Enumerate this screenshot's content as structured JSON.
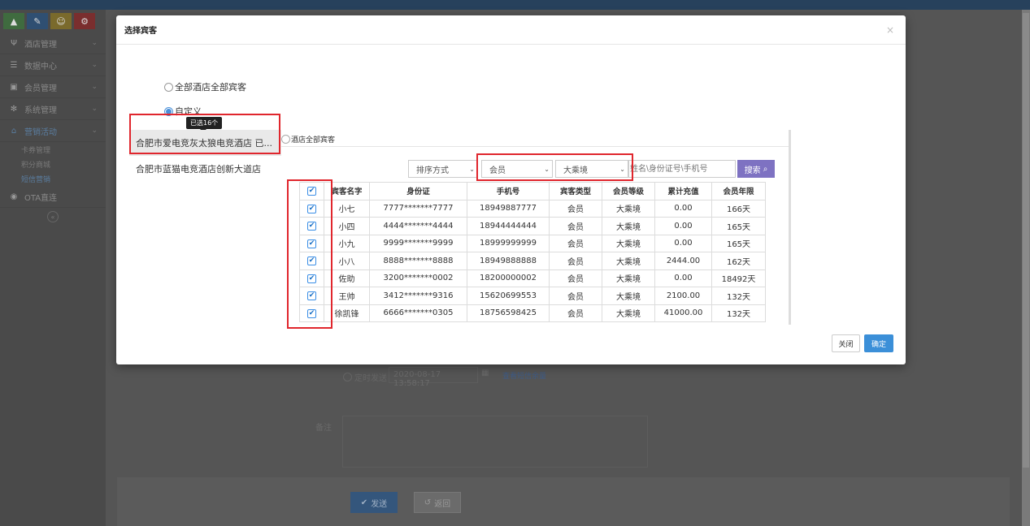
{
  "background": {
    "sidebar": {
      "top_icons": [
        "chart-icon",
        "pencil-icon",
        "users-icon",
        "cogs-icon"
      ],
      "items": [
        {
          "icon": "fork-icon",
          "label": "酒店管理"
        },
        {
          "icon": "database-icon",
          "label": "数据中心"
        },
        {
          "icon": "id-card-icon",
          "label": "会员管理"
        },
        {
          "icon": "gear-icon",
          "label": "系统管理"
        },
        {
          "icon": "gift-icon",
          "label": "营销活动"
        }
      ],
      "sub_items": [
        "卡券管理",
        "积分商城",
        "短信营销"
      ],
      "ota": {
        "icon": "eye-icon",
        "label": "OTA直连"
      }
    },
    "form": {
      "timed_send_label": "定时发送",
      "datetime_value": "2020-08-17 13:58:17",
      "check_sms_link": "查看短信余量",
      "note_label": "备注",
      "send_button": "发送",
      "back_button": "返回"
    }
  },
  "modal": {
    "title": "选择宾客",
    "close_symbol": "×",
    "option_all": "全部酒店全部宾客",
    "option_custom": "自定义",
    "tooltip": "已选16个",
    "hotels": [
      "合肥市爱电竞灰太狼电竞酒店  已...",
      "合肥市蓝猫电竞酒店创新大道店"
    ],
    "all_guests_label": "酒店全部宾客",
    "filters": {
      "sort": "排序方式",
      "type": "会员",
      "level": "大乘境",
      "search_placeholder": "姓名\\身份证号\\手机号",
      "search_button": "搜索"
    },
    "table": {
      "headers": [
        "宾客名字",
        "身份证",
        "手机号",
        "宾客类型",
        "会员等级",
        "累计充值",
        "会员年限"
      ],
      "rows": [
        [
          "小七",
          "7777*******7777",
          "18949887777",
          "会员",
          "大乘境",
          "0.00",
          "166天"
        ],
        [
          "小四",
          "4444*******4444",
          "18944444444",
          "会员",
          "大乘境",
          "0.00",
          "165天"
        ],
        [
          "小九",
          "9999*******9999",
          "18999999999",
          "会员",
          "大乘境",
          "0.00",
          "165天"
        ],
        [
          "小八",
          "8888*******8888",
          "18949888888",
          "会员",
          "大乘境",
          "2444.00",
          "162天"
        ],
        [
          "佐助",
          "3200*******0002",
          "18200000002",
          "会员",
          "大乘境",
          "0.00",
          "18492天"
        ],
        [
          "王帅",
          "3412*******9316",
          "15620699553",
          "会员",
          "大乘境",
          "2100.00",
          "132天"
        ],
        [
          "徐凯锋",
          "6666*******0305",
          "18756598425",
          "会员",
          "大乘境",
          "41000.00",
          "132天"
        ]
      ]
    },
    "buttons": {
      "close": "关闭",
      "confirm": "确定"
    }
  }
}
